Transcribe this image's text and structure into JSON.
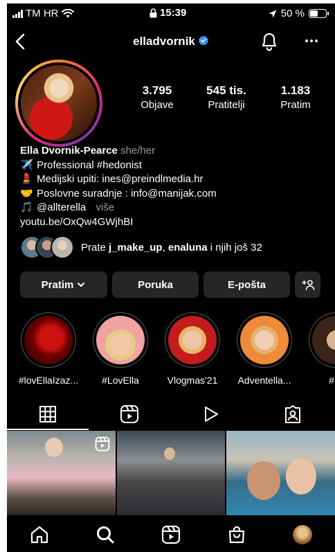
{
  "status_bar": {
    "carrier": "TM HR",
    "time": "15:39",
    "battery_text": "50 %",
    "battery_level": 0.5
  },
  "header": {
    "username": "elladvornik",
    "icons": {
      "back": "chevron-left-icon",
      "verified": "verified-badge-icon",
      "notifications": "bell-icon",
      "more": "more-horizontal-icon"
    }
  },
  "stats": [
    {
      "value": "3.795",
      "label": "Objave"
    },
    {
      "value": "545 tis.",
      "label": "Pratitelji"
    },
    {
      "value": "1.183",
      "label": "Pratim"
    }
  ],
  "bio": {
    "name": "Ella Dvornik-Pearce",
    "pronouns": "she/her",
    "lines": [
      {
        "emoji": "✈️",
        "text": "Professional #hedonist"
      },
      {
        "emoji": "💄",
        "text": "Medijski upiti: ines@preindlmedia.hr"
      },
      {
        "emoji": "🤝",
        "text": "Poslovne suradnje : info@manijak.com"
      },
      {
        "emoji": "🎵",
        "text": "@allterella"
      }
    ],
    "more_label": "više",
    "link": "youtu.be/OxQw4GWjhBI"
  },
  "followed_by": {
    "prefix": "Prate",
    "user1": "j_make_up",
    "sep": ",",
    "user2": "enaluna",
    "suffix": "i njih još 32"
  },
  "buttons": {
    "following": "Pratim",
    "message": "Poruka",
    "email": "E-pošta"
  },
  "highlights": [
    {
      "label": "#lovEllaIzaz..."
    },
    {
      "label": "#LovElla"
    },
    {
      "label": "Vlogmas'21"
    },
    {
      "label": "Adventella..."
    },
    {
      "label": "#Kr"
    }
  ],
  "tabs": [
    {
      "icon": "grid-icon"
    },
    {
      "icon": "reels-icon"
    },
    {
      "icon": "play-icon"
    },
    {
      "icon": "tagged-icon"
    }
  ],
  "bottom_nav": [
    {
      "icon": "home-icon"
    },
    {
      "icon": "search-icon"
    },
    {
      "icon": "reels-icon"
    },
    {
      "icon": "shop-icon"
    },
    {
      "icon": "profile-avatar"
    }
  ],
  "colors": {
    "background": "#000000",
    "button_bg": "#262626",
    "muted_text": "#9a9a9a",
    "verified": "#3897f0"
  }
}
